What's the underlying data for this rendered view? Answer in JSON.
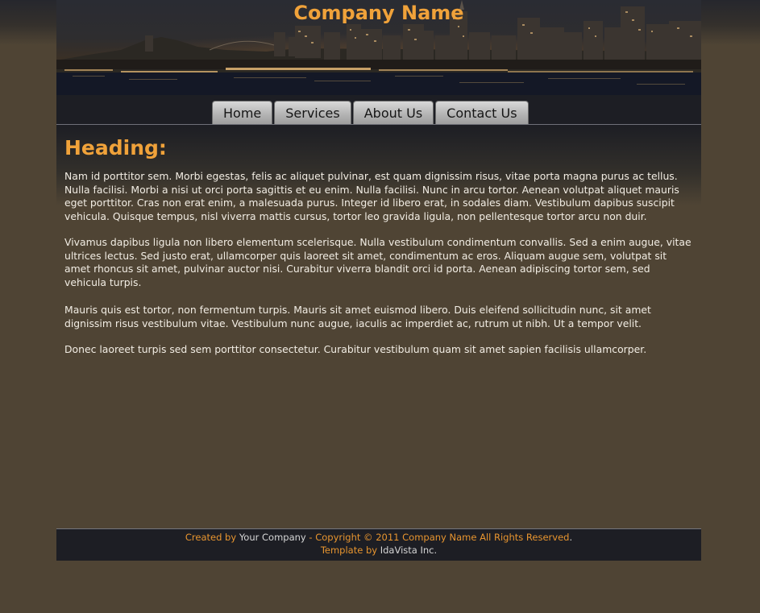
{
  "header": {
    "site_title": "Company Name"
  },
  "nav": {
    "items": [
      {
        "label": "Home"
      },
      {
        "label": "Services"
      },
      {
        "label": "About Us"
      },
      {
        "label": "Contact Us"
      }
    ]
  },
  "main": {
    "heading": "Heading:",
    "paragraphs": [
      "Nam id porttitor sem. Morbi egestas, felis ac aliquet pulvinar, est quam dignissim risus, vitae porta magna purus ac tellus. Nulla facilisi. Morbi a nisi ut orci porta sagittis et eu enim. Nulla facilisi. Nunc in arcu tortor. Aenean volutpat aliquet mauris eget porttitor. Cras non erat enim, a malesuada purus. Integer id libero erat, in sodales diam. Vestibulum dapibus suscipit vehicula. Quisque tempus, nisl viverra mattis cursus, tortor leo gravida ligula, non pellentesque tortor arcu non duir.",
      "Vivamus dapibus ligula non libero elementum scelerisque. Nulla vestibulum condimentum convallis. Sed a enim augue, vitae ultrices lectus. Sed justo erat, ullamcorper quis laoreet sit amet, condimentum ac eros. Aliquam augue sem, volutpat sit amet rhoncus sit amet, pulvinar auctor nisi. Curabitur viverra blandit orci id porta. Aenean adipiscing tortor sem, sed vehicula turpis.",
      "Mauris quis est tortor, non fermentum turpis. Mauris sit amet euismod libero. Duis eleifend sollicitudin nunc, sit amet dignissim risus vestibulum vitae. Vestibulum nunc augue, iaculis ac imperdiet ac, rutrum ut nibh. Ut a tempor velit.",
      "Donec laoreet turpis sed sem porttitor consectetur. Curabitur vestibulum quam sit amet sapien facilisis ullamcorper."
    ]
  },
  "footer": {
    "created_by_label": "Created by",
    "created_by_value": "Your Company",
    "separator": " - ",
    "copyright": "Copyright © 2011 Company Name All Rights Reserved",
    "copyright_end": ".",
    "template_by_label": "Template by",
    "template_by_value": "IdaVista Inc."
  },
  "colors": {
    "accent": "#f0a23a",
    "page_background": "#4f4434",
    "bar_background": "#1d1e24",
    "tab_background": "#b4b4b4",
    "body_text": "#f2ede4"
  }
}
